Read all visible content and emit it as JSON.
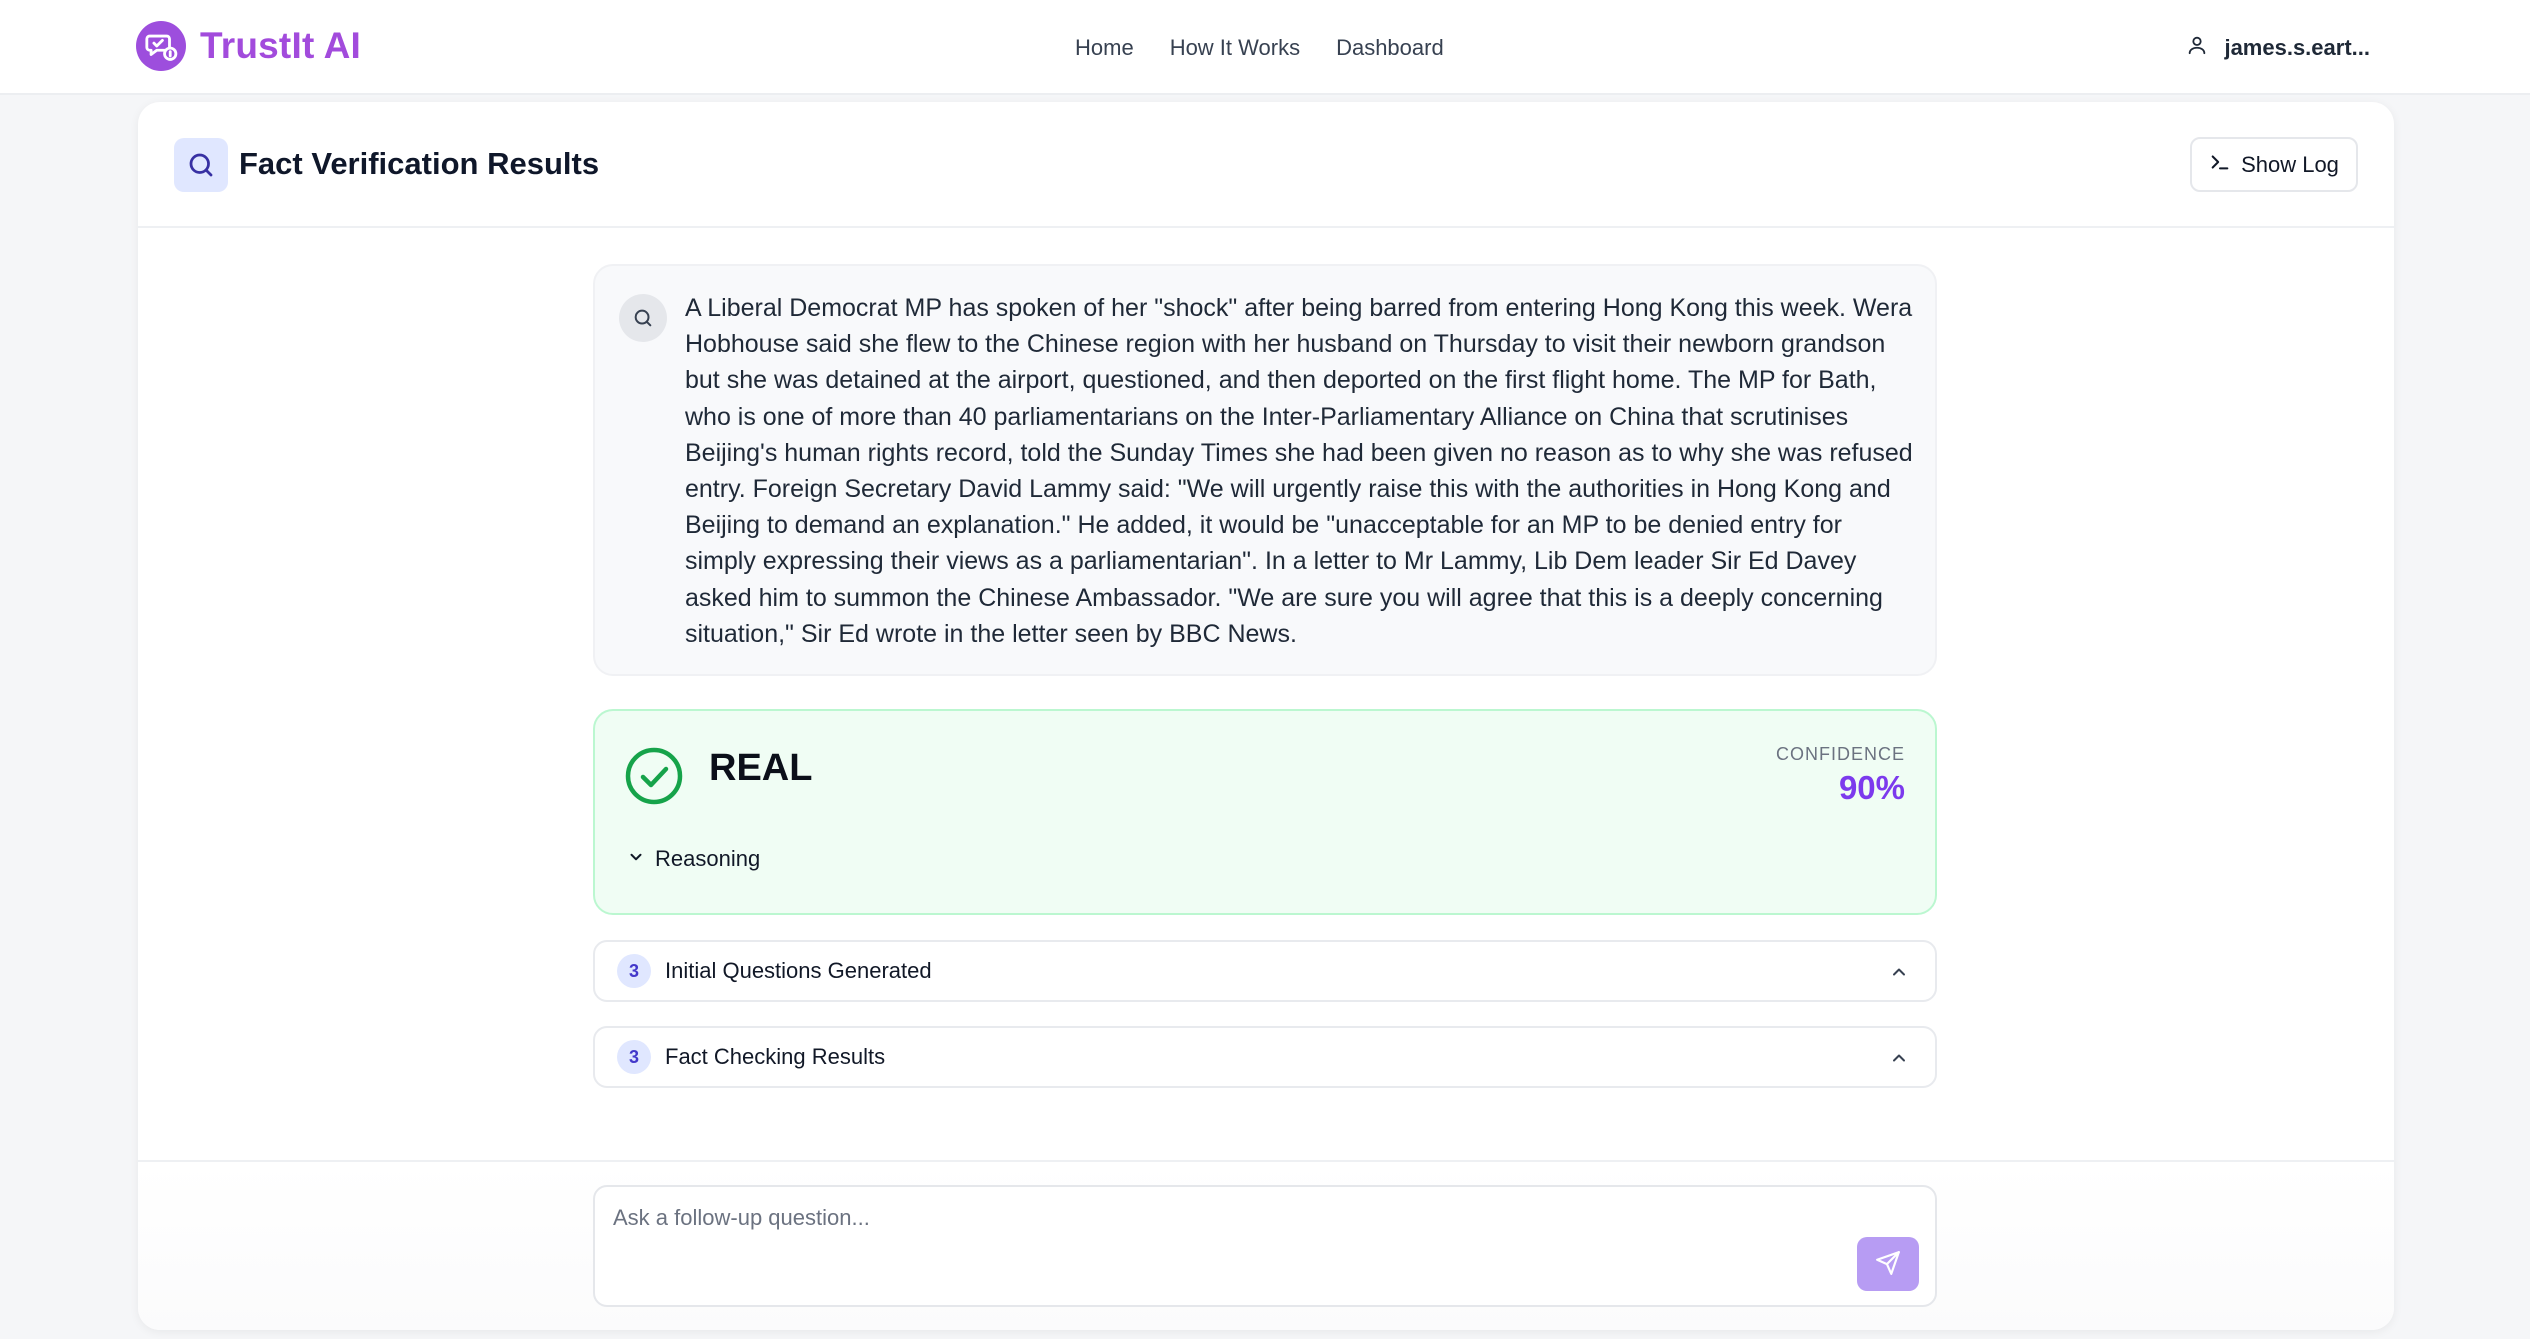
{
  "app": {
    "name": "TrustIt AI",
    "brand_color": "#a24bdc"
  },
  "nav": {
    "items": [
      {
        "label": "Home"
      },
      {
        "label": "How It Works"
      },
      {
        "label": "Dashboard"
      }
    ]
  },
  "user": {
    "name": "james.s.eart...",
    "icon": "user-icon"
  },
  "page": {
    "title": "Fact Verification Results",
    "title_icon": "search-icon",
    "show_log_label": "Show Log",
    "show_log_icon": "terminal-icon"
  },
  "claim": {
    "icon": "search-icon",
    "text": "A Liberal Democrat MP has spoken of her \"shock\" after being barred from entering Hong Kong this week. Wera Hobhouse said she flew to the Chinese region with her husband on Thursday to visit their newborn grandson but she was detained at the airport, questioned, and then deported on the first flight home. The MP for Bath, who is one of more than 40 parliamentarians on the Inter-Parliamentary Alliance on China that scrutinises Beijing's human rights record, told the Sunday Times she had been given no reason as to why she was refused entry. Foreign Secretary David Lammy said: \"We will urgently raise this with the authorities in Hong Kong and Beijing to demand an explanation.\" He added, it would be \"unacceptable for an MP to be denied entry for simply expressing their views as a parliamentarian\". In a letter to Mr Lammy, Lib Dem leader Sir Ed Davey asked him to summon the Chinese Ambassador. \"We are sure you will agree that this is a deeply concerning situation,\" Sir Ed wrote in the letter seen by BBC News."
  },
  "verdict": {
    "label": "REAL",
    "icon": "check-circle-icon",
    "status_color": "#16a34a",
    "confidence_label": "CONFIDENCE",
    "confidence_value": "90%",
    "accent_color": "#7c3aed",
    "reasoning_label": "Reasoning"
  },
  "sections": [
    {
      "count": "3",
      "label": "Initial Questions Generated"
    },
    {
      "count": "3",
      "label": "Fact Checking Results"
    }
  ],
  "followup": {
    "placeholder": "Ask a follow-up question...",
    "send_icon": "send-icon"
  }
}
